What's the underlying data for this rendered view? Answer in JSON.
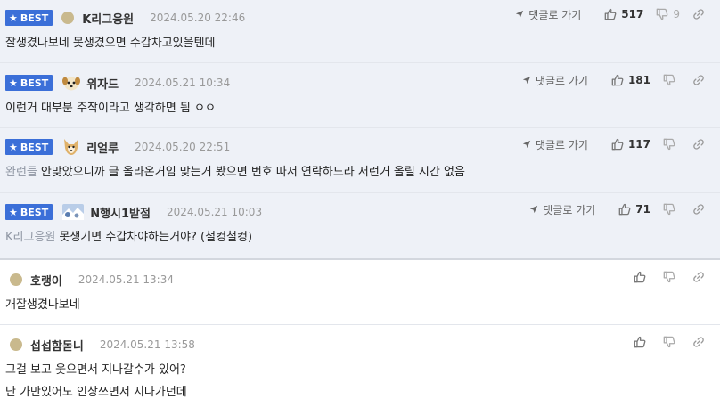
{
  "comments": [
    {
      "best": true,
      "badge": "BEST",
      "nick": "K리그응원",
      "date": "2024.05.20 22:46",
      "goto": "댓글로 가기",
      "likes": "517",
      "dislikes": "9",
      "prefix": "",
      "lines": [
        "잘생겼나보네 못생겼으면 수갑차고있을텐데"
      ]
    },
    {
      "best": true,
      "badge": "BEST",
      "nick": "위자드",
      "date": "2024.05.21 10:34",
      "goto": "댓글로 가기",
      "likes": "181",
      "dislikes": "",
      "prefix": "",
      "lines": [
        "이런거 대부분 주작이라고 생각하면 됨 ㅇㅇ"
      ]
    },
    {
      "best": true,
      "badge": "BEST",
      "nick": "리얼루",
      "date": "2024.05.20 22:51",
      "goto": "댓글로 가기",
      "likes": "117",
      "dislikes": "",
      "prefix": "완런들",
      "lines": [
        "안맞았으니까 글 올라온거임 맞는거 봤으면 번호 따서 연락하느라 저런거 올릴 시간 없음"
      ]
    },
    {
      "best": true,
      "badge": "BEST",
      "nick": "N행시1받점",
      "date": "2024.05.21 10:03",
      "goto": "댓글로 가기",
      "likes": "71",
      "dislikes": "",
      "prefix": "K리그응원",
      "lines": [
        "못생기면 수갑차야하는거야? (철컹철컹)"
      ]
    },
    {
      "best": false,
      "nick": "호랭이",
      "date": "2024.05.21 13:34",
      "prefix": "",
      "lines": [
        "개잘생겼나보네"
      ]
    },
    {
      "best": false,
      "nick": "섭섭함돋니",
      "date": "2024.05.21 13:58",
      "prefix": "",
      "lines": [
        "그걸 보고 웃으면서 지나갈수가 있어?",
        "난 가만있어도 인상쓰면서 지나가던데"
      ]
    }
  ],
  "colors": {
    "best_bg": "#eef1f7",
    "badge": "#3b6fd8",
    "avatar_default": "#c9b98d"
  }
}
